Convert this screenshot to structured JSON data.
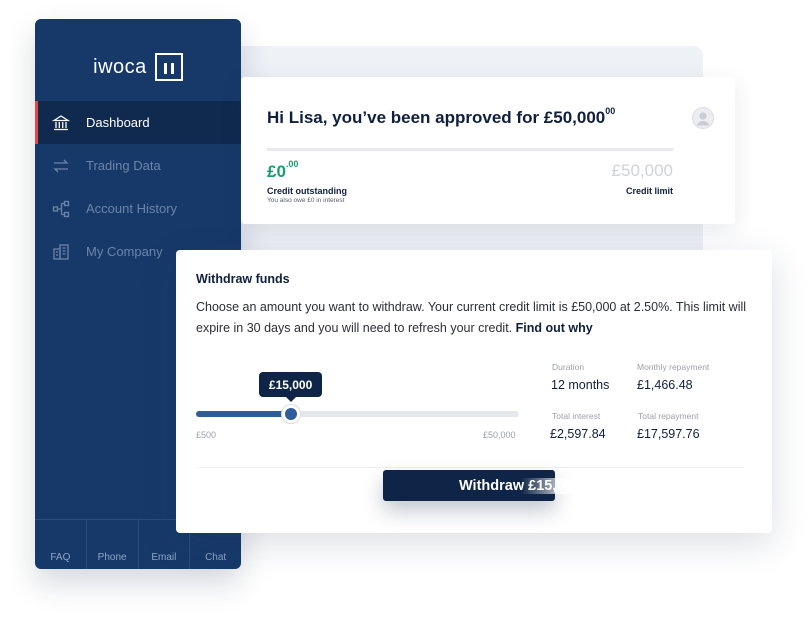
{
  "brand": {
    "logo_text": "iwoca"
  },
  "sidebar": {
    "items": [
      {
        "label": "Dashboard",
        "icon": "bank-icon",
        "active": true
      },
      {
        "label": "Trading Data",
        "icon": "swap-arrows-icon",
        "active": false
      },
      {
        "label": "Account History",
        "icon": "hierarchy-icon",
        "active": false
      },
      {
        "label": "My Company",
        "icon": "building-icon",
        "active": false
      }
    ],
    "footer": [
      "FAQ",
      "Phone",
      "Email",
      "Chat"
    ]
  },
  "approval": {
    "greeting": "Hi Lisa, you’ve been approved for £50,000",
    "greeting_pence": "00",
    "credit_outstanding_value": "£0",
    "credit_outstanding_pence": ".00",
    "credit_outstanding_label": "Credit outstanding",
    "credit_outstanding_note": "You also owe £0 in interest",
    "credit_limit_value": "£50,000",
    "credit_limit_label": "Credit limit"
  },
  "withdraw": {
    "title": "Withdraw funds",
    "description": "Choose an amount you want to withdraw. Your current credit limit is £50,000 at 2.50%. This limit will expire in 30 days and you will need to refresh your credit.",
    "find_out_link": "Find out why",
    "slider": {
      "min_label": "£500",
      "max_label": "£50,000",
      "min": 500,
      "max": 50000,
      "value": 15000,
      "value_label": "£15,000"
    },
    "stats": {
      "duration_label": "Duration",
      "duration_value": "12 months",
      "monthly_label": "Monthly repayment",
      "monthly_value": "£1,466.48",
      "interest_label": "Total interest",
      "interest_value": "£2,597.84",
      "repayment_label": "Total repayment",
      "repayment_value": "£17,597.76"
    },
    "button_label": "Withdraw £15,000"
  },
  "colors": {
    "sidebar_bg": "#17396a",
    "accent_red": "#e0493f",
    "green": "#1a9c6e",
    "navy": "#0f2547",
    "slider_blue": "#2f5c9c"
  }
}
